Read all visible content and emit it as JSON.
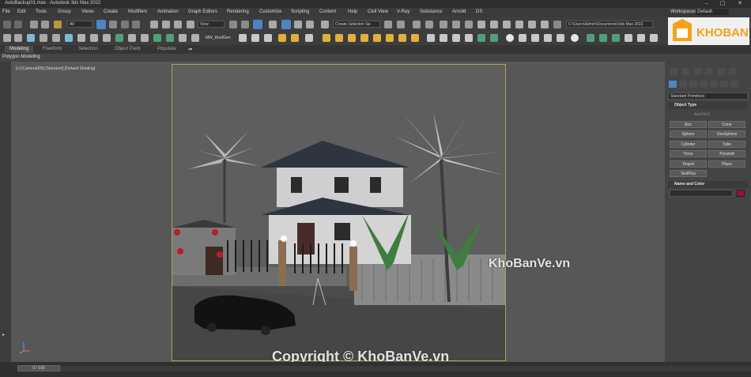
{
  "window": {
    "title": "AutoBackup01.max - Autodesk 3ds Max 2022"
  },
  "menu": {
    "items": [
      "File",
      "Edit",
      "Tools",
      "Group",
      "Views",
      "Create",
      "Modifiers",
      "Animation",
      "Graph Editors",
      "Rendering",
      "Customize",
      "Scripting",
      "Content",
      "Help",
      "Civil View",
      "V-Ray",
      "Substance",
      "Arnold",
      "DS"
    ],
    "workspaces_label": "Workspaces:",
    "workspaces_value": "Default"
  },
  "toolbar": {
    "selection_filter": "All",
    "reference_coord": "View",
    "selection_set": "Create Selection Se",
    "project_path": "C:\\Users\\Admin\\Documents\\3ds Max 2022",
    "modifier_label": "MW_RoofGen"
  },
  "ribbon": {
    "tabs": [
      "Modeling",
      "Freeform",
      "Selection",
      "Object Paint",
      "Populate"
    ],
    "active_tab": "Modeling",
    "panel_label": "Polygon Modeling"
  },
  "viewport": {
    "label": "[+] [Camera006] [Standard] [Default Shading]"
  },
  "command_panel": {
    "category": "Standard Primitives",
    "object_type_title": "Object Type",
    "autogrid_label": "AutoGrid",
    "buttons": [
      "Box",
      "Cone",
      "Sphere",
      "GeoSphere",
      "Cylinder",
      "Tube",
      "Torus",
      "Pyramid",
      "Teapot",
      "Plane",
      "TextPlus"
    ],
    "name_color_title": "Name and Color",
    "object_color": "#a0103a"
  },
  "timeline": {
    "frame": "0 / 100"
  },
  "watermarks": {
    "logo_text": "KHOBANVE",
    "center_text": "KhoBanVe.vn",
    "copyright_text": "Copyright © KhoBanVe.vn"
  }
}
